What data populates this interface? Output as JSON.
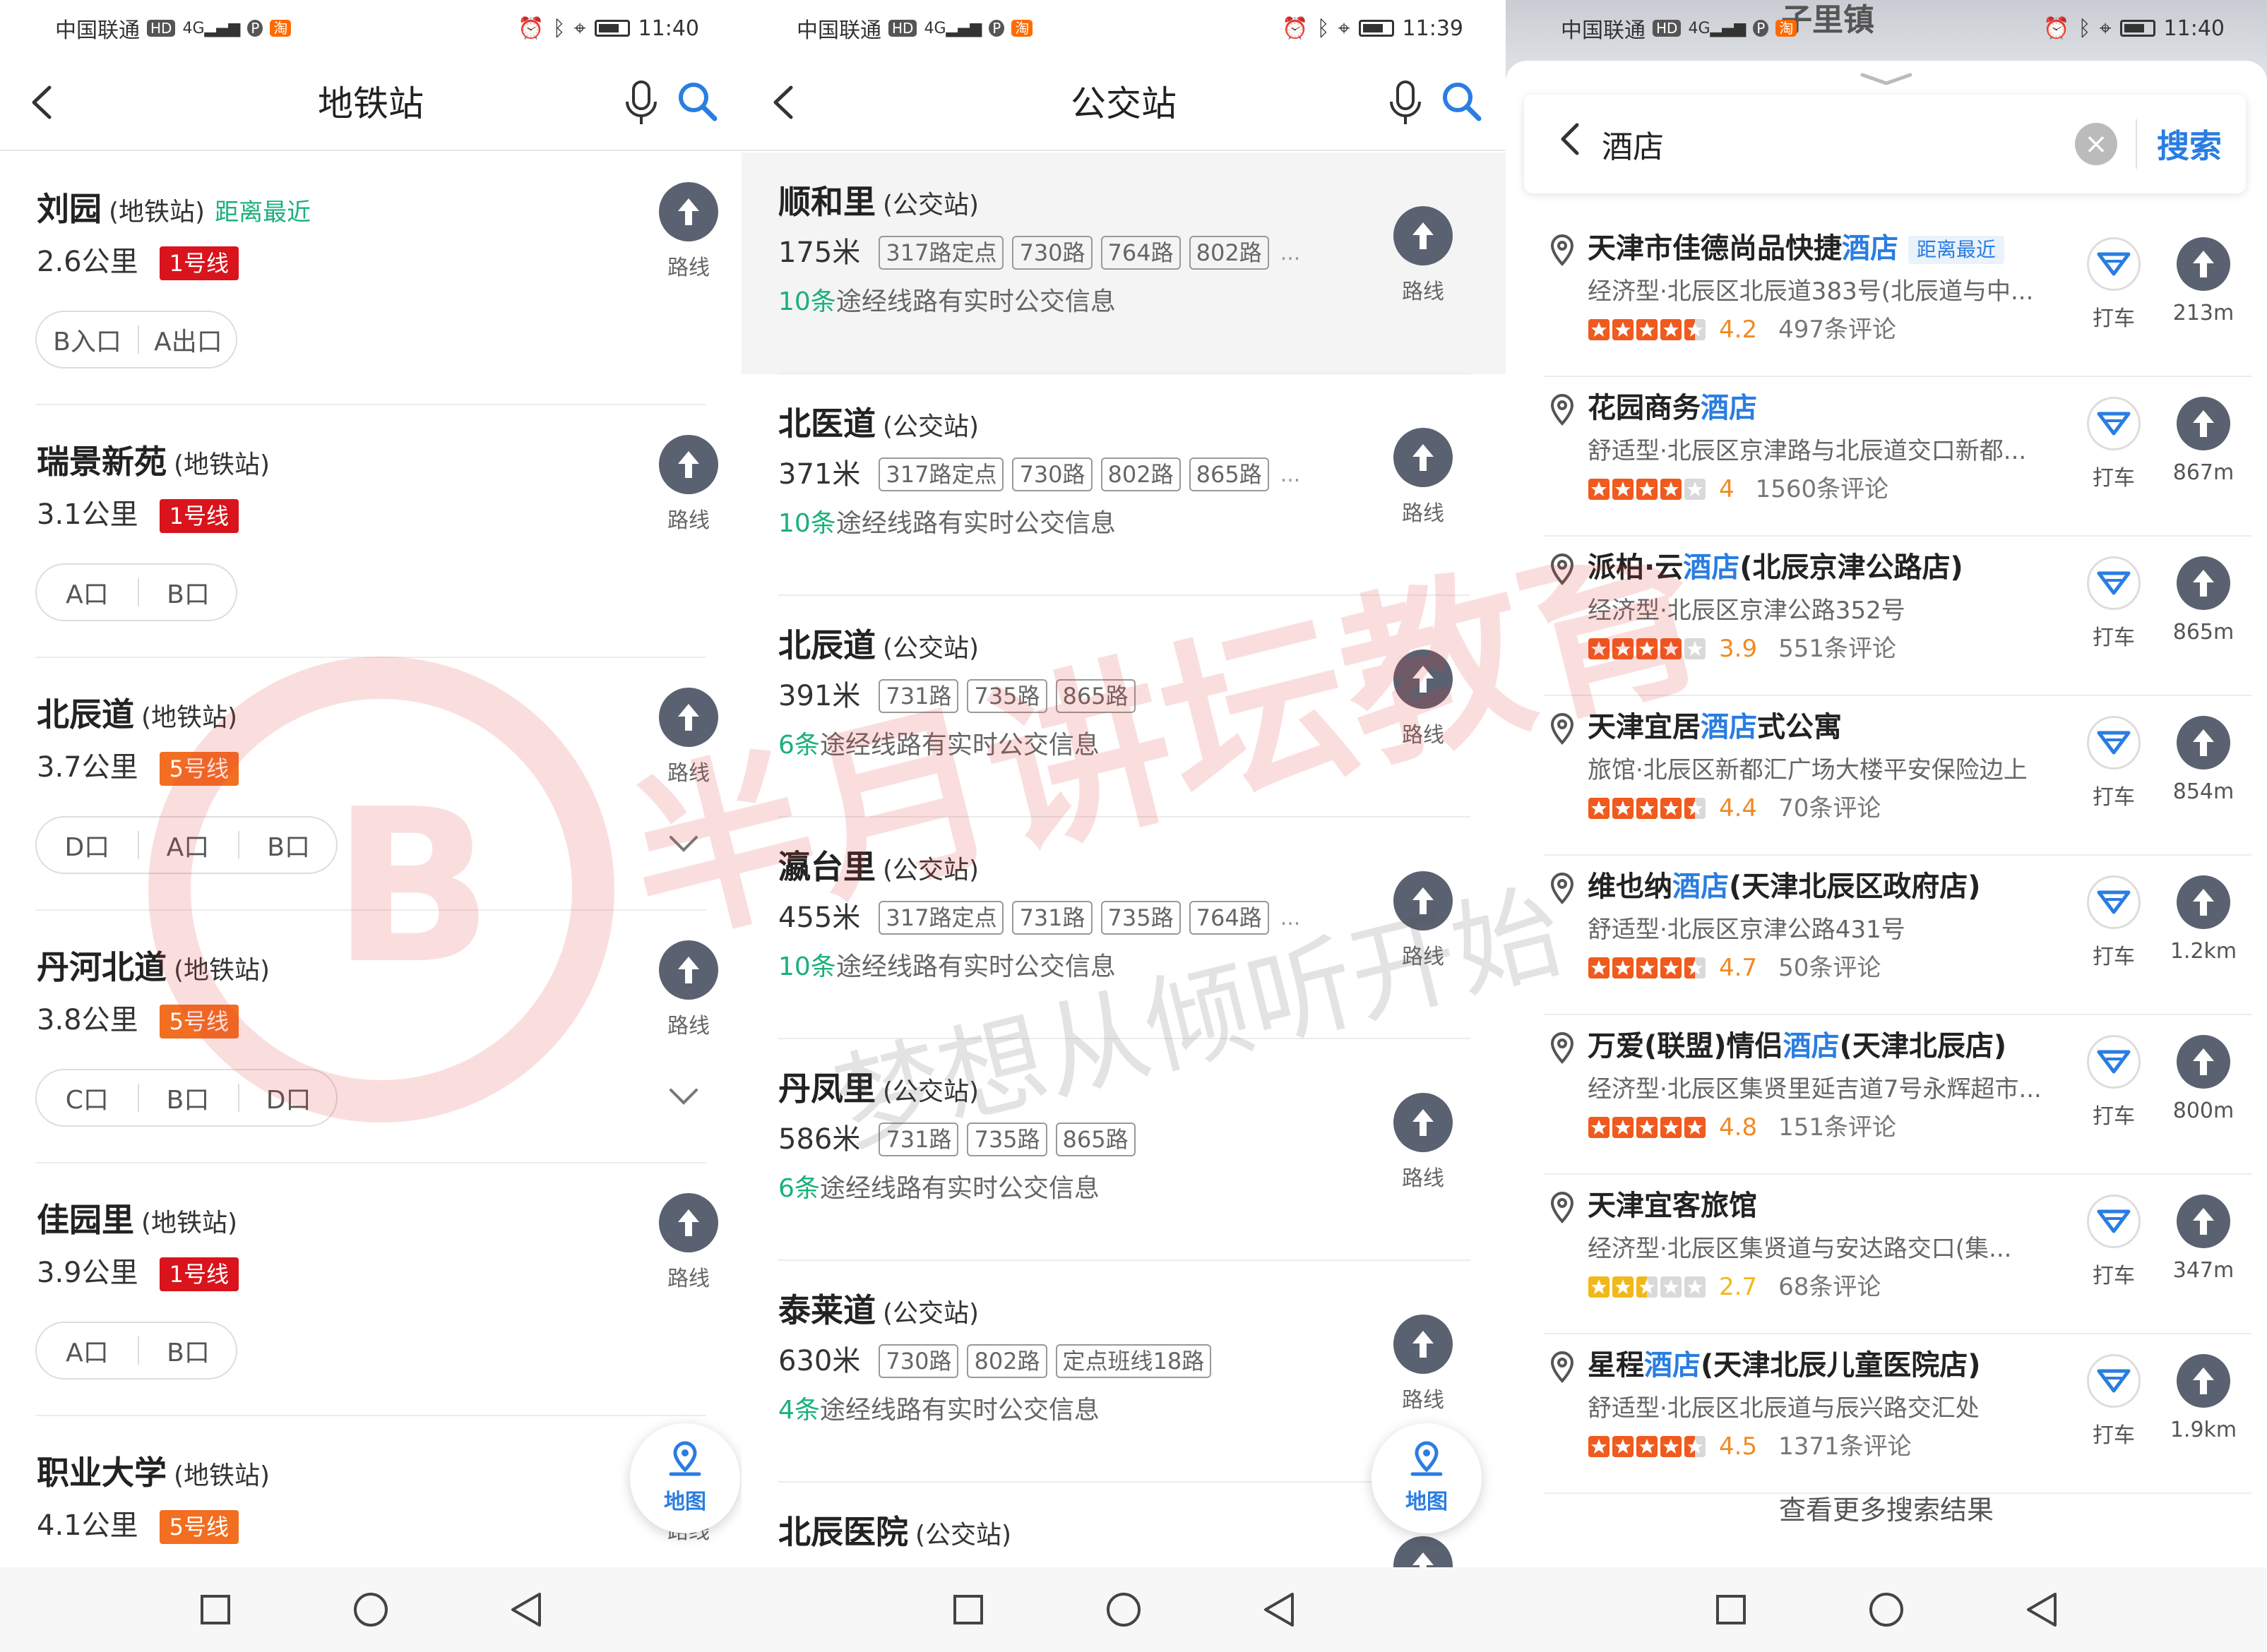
{
  "status": {
    "carrier": "中国联通",
    "hd": "HD",
    "net": "4G",
    "p_badge": "P",
    "taobao_badge": "淘",
    "panels": [
      {
        "time": "11:40"
      },
      {
        "time": "11:39"
      },
      {
        "time": "11:40"
      }
    ]
  },
  "metro": {
    "title": "地铁站",
    "route_label": "路线",
    "map_label": "地图",
    "items": [
      {
        "name": "刘园",
        "type": "(地铁站)",
        "nearest": "距离最近",
        "dist": "2.6公里",
        "line": "1号线",
        "line_color": "#d9141c",
        "exits": [
          "B入口",
          "A出口"
        ]
      },
      {
        "name": "瑞景新苑",
        "type": "(地铁站)",
        "nearest": "",
        "dist": "3.1公里",
        "line": "1号线",
        "line_color": "#d9141c",
        "exits": [
          "A口",
          "B口"
        ]
      },
      {
        "name": "北辰道",
        "type": "(地铁站)",
        "nearest": "",
        "dist": "3.7公里",
        "line": "5号线",
        "line_color": "#f26e21",
        "exits": [
          "D口",
          "A口",
          "B口"
        ]
      },
      {
        "name": "丹河北道",
        "type": "(地铁站)",
        "nearest": "",
        "dist": "3.8公里",
        "line": "5号线",
        "line_color": "#f26e21",
        "exits": [
          "C口",
          "B口",
          "D口"
        ]
      },
      {
        "name": "佳园里",
        "type": "(地铁站)",
        "nearest": "",
        "dist": "3.9公里",
        "line": "1号线",
        "line_color": "#d9141c",
        "exits": [
          "A口",
          "B口"
        ]
      },
      {
        "name": "职业大学",
        "type": "(地铁站)",
        "nearest": "",
        "dist": "4.1公里",
        "line": "5号线",
        "line_color": "#f26e21",
        "exits": []
      }
    ]
  },
  "bus": {
    "title": "公交站",
    "route_label": "路线",
    "map_label": "地图",
    "more": "...",
    "items": [
      {
        "name": "顺和里",
        "type": "(公交站)",
        "dist": "175米",
        "routes": [
          "317路定点",
          "730路",
          "764路",
          "802路"
        ],
        "more": true,
        "rt_count": "10条",
        "rt_text": "途经线路有实时公交信息"
      },
      {
        "name": "北医道",
        "type": "(公交站)",
        "dist": "371米",
        "routes": [
          "317路定点",
          "730路",
          "802路",
          "865路"
        ],
        "more": true,
        "rt_count": "10条",
        "rt_text": "途经线路有实时公交信息"
      },
      {
        "name": "北辰道",
        "type": "(公交站)",
        "dist": "391米",
        "routes": [
          "731路",
          "735路",
          "865路"
        ],
        "more": false,
        "rt_count": "6条",
        "rt_text": "途经线路有实时公交信息"
      },
      {
        "name": "瀛台里",
        "type": "(公交站)",
        "dist": "455米",
        "routes": [
          "317路定点",
          "731路",
          "735路",
          "764路"
        ],
        "more": true,
        "rt_count": "10条",
        "rt_text": "途经线路有实时公交信息"
      },
      {
        "name": "丹凤里",
        "type": "(公交站)",
        "dist": "586米",
        "routes": [
          "731路",
          "735路",
          "865路"
        ],
        "more": false,
        "rt_count": "6条",
        "rt_text": "途经线路有实时公交信息"
      },
      {
        "name": "泰莱道",
        "type": "(公交站)",
        "dist": "630米",
        "routes": [
          "730路",
          "802路",
          "定点班线18路"
        ],
        "more": false,
        "rt_count": "4条",
        "rt_text": "途经线路有实时公交信息"
      },
      {
        "name": "北辰医院",
        "type": "(公交站)",
        "dist": "",
        "routes": [],
        "more": false,
        "rt_count": "",
        "rt_text": ""
      }
    ]
  },
  "hotel_search": {
    "map_town": "子里镇",
    "query": "酒店",
    "search_button": "搜索",
    "taxi_label": "打车",
    "more_results": "查看更多搜索结果",
    "results": [
      {
        "name_pre": "天津市佳德尚品快捷",
        "name_hl": "酒店",
        "name_post": "",
        "nearest": "距离最近",
        "addr": "经济型·北辰区北辰道383号(北辰道与中...",
        "stars": 4.5,
        "score": "4.2",
        "reviews": "497条评论",
        "dist": "213m"
      },
      {
        "name_pre": "花园商务",
        "name_hl": "酒店",
        "name_post": "",
        "nearest": "",
        "addr": "舒适型·北辰区京津路与北辰道交口新都...",
        "stars": 4,
        "score": "4",
        "reviews": "1560条评论",
        "dist": "867m"
      },
      {
        "name_pre": "派柏·云",
        "name_hl": "酒店",
        "name_post": "(北辰京津公路店)",
        "nearest": "",
        "addr": "经济型·北辰区京津公路352号",
        "stars": 4,
        "score": "3.9",
        "reviews": "551条评论",
        "dist": "865m"
      },
      {
        "name_pre": "天津宜居",
        "name_hl": "酒店",
        "name_post": "式公寓",
        "nearest": "",
        "addr": "旅馆·北辰区新都汇广场大楼平安保险边上",
        "stars": 4.5,
        "score": "4.4",
        "reviews": "70条评论",
        "dist": "854m"
      },
      {
        "name_pre": "维也纳",
        "name_hl": "酒店",
        "name_post": "(天津北辰区政府店)",
        "nearest": "",
        "addr": "舒适型·北辰区京津公路431号",
        "stars": 4.5,
        "score": "4.7",
        "reviews": "50条评论",
        "dist": "1.2km"
      },
      {
        "name_pre": "万爱(联盟)情侣",
        "name_hl": "酒店",
        "name_post": "(天津北辰店)",
        "nearest": "",
        "addr": "经济型·北辰区集贤里延吉道7号永辉超市...",
        "stars": 5,
        "score": "4.8",
        "reviews": "151条评论",
        "dist": "800m"
      },
      {
        "name_pre": "天津宜客旅馆",
        "name_hl": "",
        "name_post": "",
        "nearest": "",
        "addr": "经济型·北辰区集贤道与安达路交口(集...",
        "stars": 2.5,
        "score": "2.7",
        "reviews": "68条评论",
        "dist": "347m"
      },
      {
        "name_pre": "星程",
        "name_hl": "酒店",
        "name_post": "(天津北辰儿童医院店)",
        "nearest": "",
        "addr": "舒适型·北辰区北辰道与辰兴路交汇处",
        "stars": 4.5,
        "score": "4.5",
        "reviews": "1371条评论",
        "dist": "1.9km"
      }
    ]
  },
  "watermark": {
    "line1": "半月讲坛教育",
    "line2": "梦想从倾听开始"
  },
  "colors": {
    "accent_blue": "#2a7de1",
    "green": "#19b17a",
    "route_btn": "#5a6170",
    "star_orange": "#f05a1e",
    "star_yellow": "#f2b81b"
  }
}
